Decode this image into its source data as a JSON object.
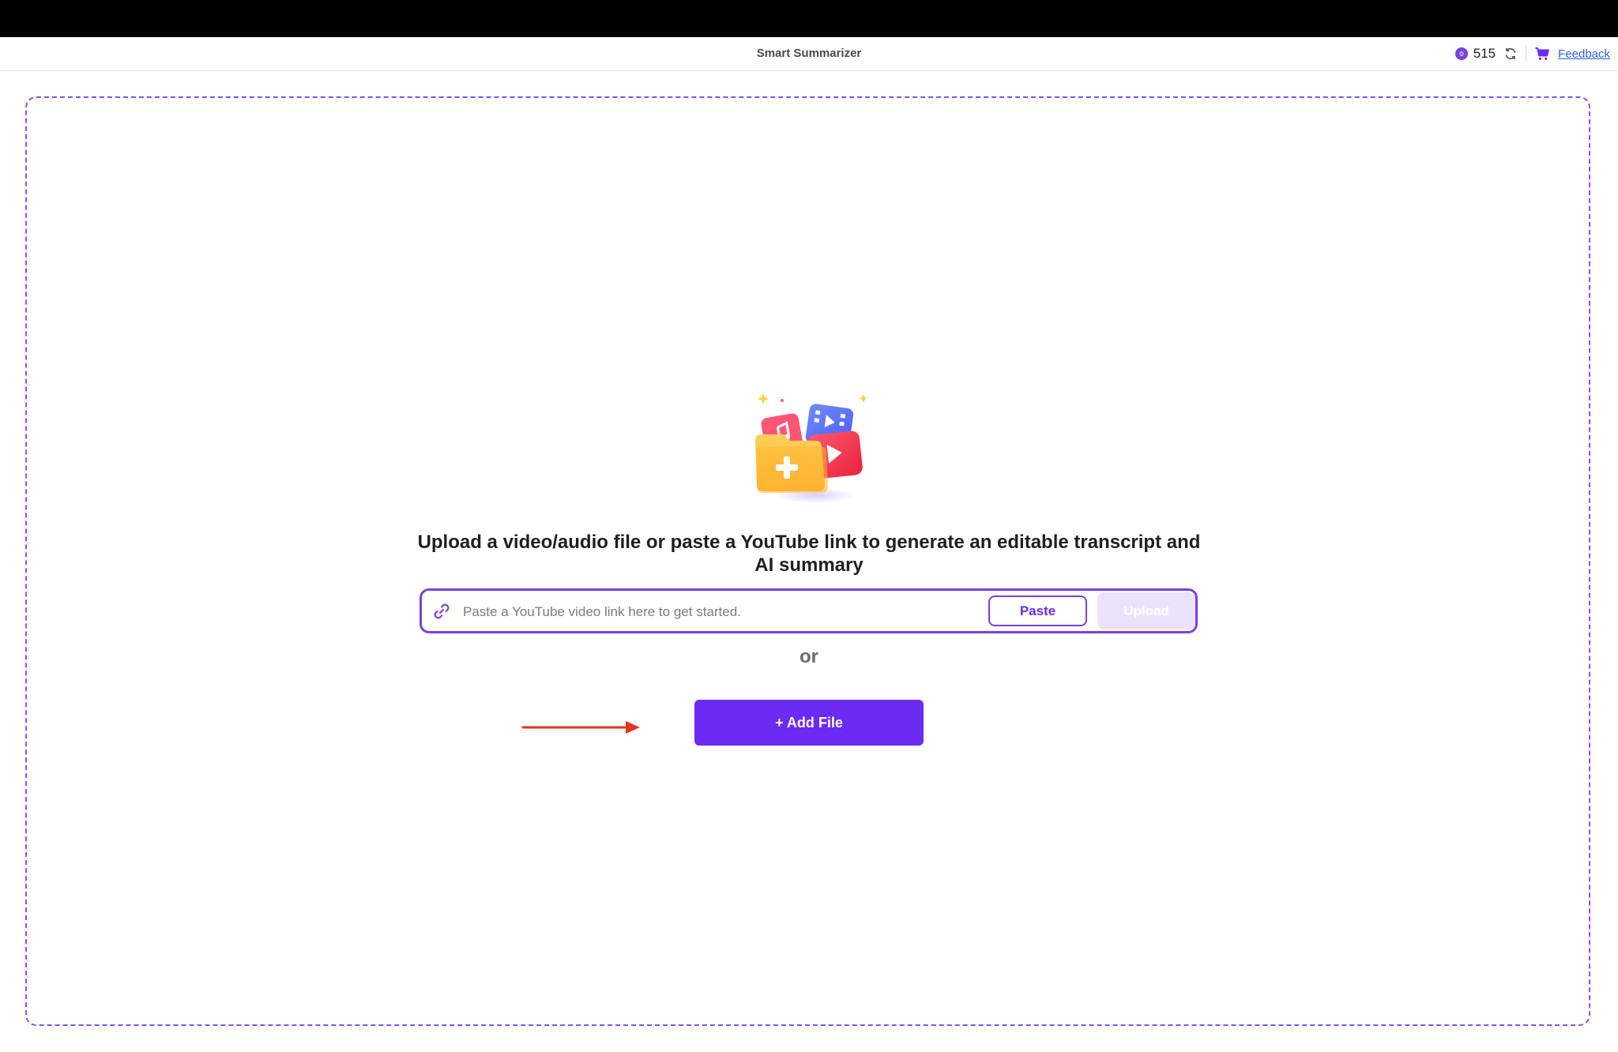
{
  "window": {
    "title": "Smart Summarizer"
  },
  "header": {
    "credit_count": "515",
    "feedback_label": "Feedback",
    "icons": [
      "credit-icon",
      "refresh-icon",
      "cart-icon"
    ]
  },
  "main": {
    "headline": "Upload a video/audio file or paste a YouTube link to generate an editable transcript and AI summary",
    "link_input": {
      "value": "",
      "placeholder": "Paste a YouTube video link here to get started."
    },
    "paste_label": "Paste",
    "upload_label": "Upload",
    "or_label": "or",
    "add_file_label": "+ Add File"
  },
  "colors": {
    "accent": "#6c2bf2",
    "border": "#8a4dff",
    "upload_disabled": "#ebe3fb",
    "annotation_arrow": "#e8321e",
    "feedback_link": "#2f5fe0"
  }
}
